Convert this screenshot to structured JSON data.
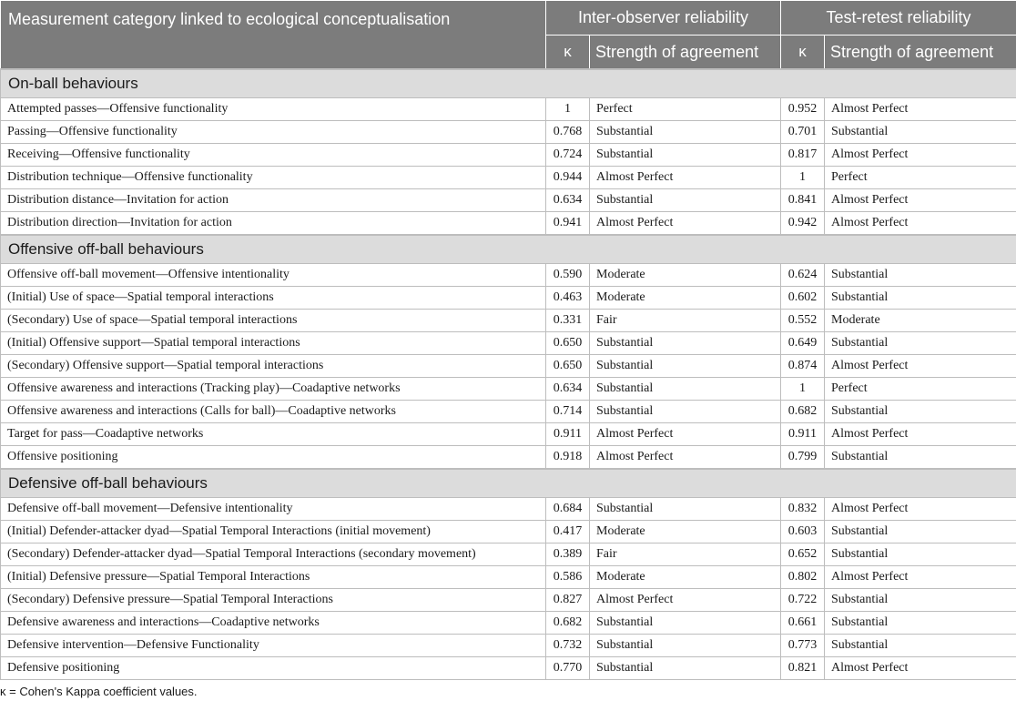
{
  "header": {
    "col_measure": "Measurement category linked to ecological conceptualisation",
    "group_inter": "Inter-observer reliability",
    "group_test": "Test-retest reliability",
    "kappa": "κ",
    "strength": "Strength of agreement"
  },
  "sections": [
    {
      "title": "On-ball behaviours",
      "rows": [
        [
          "Attempted passes—Offensive functionality",
          "1",
          "Perfect",
          "0.952",
          "Almost Perfect"
        ],
        [
          "Passing—Offensive functionality",
          "0.768",
          "Substantial",
          "0.701",
          "Substantial"
        ],
        [
          "Receiving—Offensive functionality",
          "0.724",
          "Substantial",
          "0.817",
          "Almost Perfect"
        ],
        [
          "Distribution technique—Offensive functionality",
          "0.944",
          "Almost Perfect",
          "1",
          "Perfect"
        ],
        [
          "Distribution distance—Invitation for action",
          "0.634",
          "Substantial",
          "0.841",
          "Almost Perfect"
        ],
        [
          "Distribution direction—Invitation for action",
          "0.941",
          "Almost Perfect",
          "0.942",
          "Almost Perfect"
        ]
      ]
    },
    {
      "title": "Offensive off-ball behaviours",
      "rows": [
        [
          "Offensive off-ball movement—Offensive intentionality",
          "0.590",
          "Moderate",
          "0.624",
          "Substantial"
        ],
        [
          "(Initial) Use of space—Spatial temporal interactions",
          "0.463",
          "Moderate",
          "0.602",
          "Substantial"
        ],
        [
          "(Secondary) Use of space—Spatial temporal interactions",
          "0.331",
          "Fair",
          "0.552",
          "Moderate"
        ],
        [
          "(Initial) Offensive support—Spatial temporal interactions",
          "0.650",
          "Substantial",
          "0.649",
          "Substantial"
        ],
        [
          "(Secondary) Offensive support—Spatial temporal interactions",
          "0.650",
          "Substantial",
          "0.874",
          "Almost Perfect"
        ],
        [
          "Offensive awareness and interactions (Tracking play)—Coadaptive networks",
          "0.634",
          "Substantial",
          "1",
          "Perfect"
        ],
        [
          "Offensive awareness and interactions (Calls for ball)—Coadaptive networks",
          "0.714",
          "Substantial",
          "0.682",
          "Substantial"
        ],
        [
          "Target for pass—Coadaptive networks",
          "0.911",
          "Almost Perfect",
          "0.911",
          "Almost Perfect"
        ],
        [
          "Offensive positioning",
          "0.918",
          "Almost Perfect",
          "0.799",
          "Substantial"
        ]
      ]
    },
    {
      "title": "Defensive off-ball behaviours",
      "rows": [
        [
          "Defensive off-ball movement—Defensive intentionality",
          "0.684",
          "Substantial",
          "0.832",
          "Almost Perfect"
        ],
        [
          "(Initial) Defender-attacker dyad—Spatial Temporal Interactions (initial movement)",
          "0.417",
          "Moderate",
          "0.603",
          "Substantial"
        ],
        [
          "(Secondary) Defender-attacker dyad—Spatial Temporal Interactions (secondary movement)",
          "0.389",
          "Fair",
          "0.652",
          "Substantial"
        ],
        [
          "(Initial) Defensive pressure—Spatial Temporal Interactions",
          "0.586",
          "Moderate",
          "0.802",
          "Almost Perfect"
        ],
        [
          "(Secondary) Defensive pressure—Spatial Temporal Interactions",
          "0.827",
          "Almost Perfect",
          "0.722",
          "Substantial"
        ],
        [
          "Defensive awareness and interactions—Coadaptive networks",
          "0.682",
          "Substantial",
          "0.661",
          "Substantial"
        ],
        [
          "Defensive intervention—Defensive Functionality",
          "0.732",
          "Substantial",
          "0.773",
          "Substantial"
        ],
        [
          "Defensive positioning",
          "0.770",
          "Substantial",
          "0.821",
          "Almost Perfect"
        ]
      ]
    }
  ],
  "footnote": "κ = Cohen's Kappa coefficient values."
}
